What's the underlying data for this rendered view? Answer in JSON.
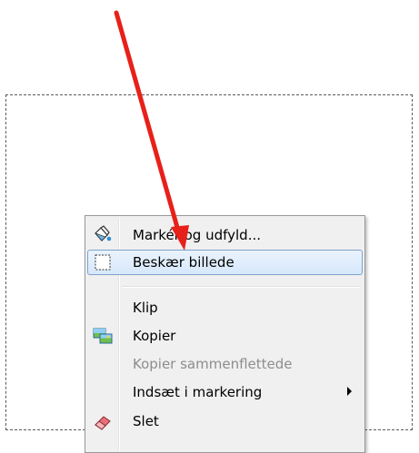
{
  "context_menu": {
    "items": [
      {
        "label": "Markér og udfyld...",
        "icon": "select-fill-icon",
        "enabled": true
      },
      {
        "label": "Beskær billede",
        "icon": "crop-icon",
        "enabled": true,
        "highlighted": true
      },
      {
        "label": "Klip",
        "icon": null,
        "enabled": true
      },
      {
        "label": "Kopier",
        "icon": "copy-image-icon",
        "enabled": true
      },
      {
        "label": "Kopier sammenflettede",
        "icon": null,
        "enabled": false
      },
      {
        "label": "Indsæt i markering",
        "icon": null,
        "enabled": true,
        "submenu": true
      },
      {
        "label": "Slet",
        "icon": "eraser-icon",
        "enabled": true
      }
    ]
  },
  "annotation": {
    "arrow_color": "#e8201a"
  },
  "colors": {
    "highlight_border": "#7da2ce",
    "menu_background": "#f0f0f0",
    "disabled_text": "#8d8d8d"
  }
}
